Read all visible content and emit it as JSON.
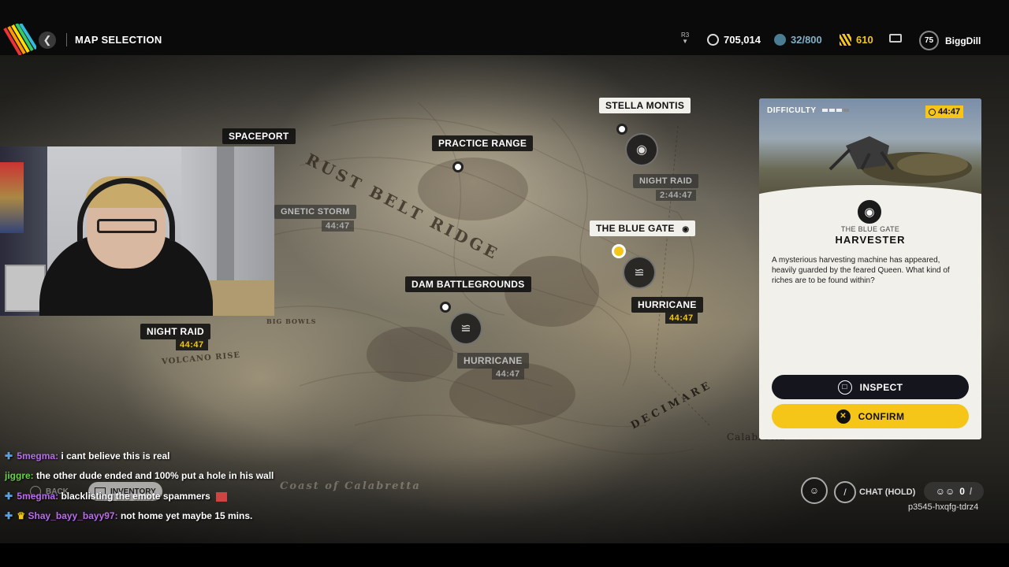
{
  "header": {
    "title": "MAP SELECTION",
    "back_icon": "chevron-left-icon",
    "r3_hint": "R3",
    "currencies": [
      {
        "name": "coins",
        "value": "705,014",
        "icon": "coin-icon",
        "color": "#ffffff"
      },
      {
        "name": "stash",
        "value": "32/800",
        "icon": "stash-icon",
        "color": "#7fb0c8"
      },
      {
        "name": "raider-tokens",
        "value": "610",
        "icon": "token-icon",
        "color": "#f5c518"
      }
    ],
    "mail_icon": "inbox-icon",
    "player": {
      "level": "75",
      "name": "BiggDill"
    }
  },
  "map": {
    "terrain_labels": {
      "rust_belt_ridge": "RUST BELT RIDGE",
      "decimare": "DECIMARE",
      "volcano_rise": "VOLCANO RISE",
      "big_bowls": "BIG BOWLS",
      "coast": "Coast of Calabretta",
      "calabretta": "Calabretta"
    },
    "locations": {
      "spaceport": {
        "name": "SPACEPORT"
      },
      "practice_range": {
        "name": "PRACTICE RANGE"
      },
      "stella_montis": {
        "name": "STELLA MONTIS",
        "condition": "NIGHT RAID",
        "timer": "2:44:47"
      },
      "blue_gate": {
        "name": "THE BLUE GATE",
        "condition": "HURRICANE",
        "timer": "44:47"
      },
      "dam": {
        "name": "DAM BATTLEGROUNDS",
        "condition": "HURRICANE",
        "timer": "44:47"
      },
      "buried_city": {
        "condition": "NIGHT RAID",
        "timer": "44:47"
      },
      "west": {
        "condition": "GNETIC STORM",
        "timer": "44:47"
      }
    }
  },
  "panel": {
    "difficulty_label": "DIFFICULTY",
    "difficulty_level": 3,
    "timer": "44:47",
    "subtitle": "THE BLUE GATE",
    "title": "HARVESTER",
    "description": "A mysterious harvesting machine has appeared, heavily guarded by the feared Queen. What kind of riches are to be found within?",
    "inspect_label": "INSPECT",
    "confirm_label": "CONFIRM"
  },
  "chat": [
    {
      "user": "5megma",
      "user_color": "#b86cf0",
      "text": "i cant believe this is real"
    },
    {
      "user": "jiggre",
      "user_color": "#6cd04a",
      "text": "the other dude ended and 100% put a hole in his wall"
    },
    {
      "user": "5megma",
      "user_color": "#b86cf0",
      "text": "blacklisting the emote spammers"
    },
    {
      "user": "Shay_bayy_bayy97",
      "user_color": "#b86cf0",
      "text": "not home yet maybe 15 mins."
    }
  ],
  "footer": {
    "back_label": "BACK",
    "inventory_label": "INVENTORY",
    "chat_hold_label": "CHAT (HOLD)",
    "party_count": "0",
    "room_code": "p3545-hxqfg-tdrz4"
  },
  "colors": {
    "accent": "#f5c518",
    "panel_bg": "#f2f0ea",
    "dark_button": "#14151d"
  }
}
